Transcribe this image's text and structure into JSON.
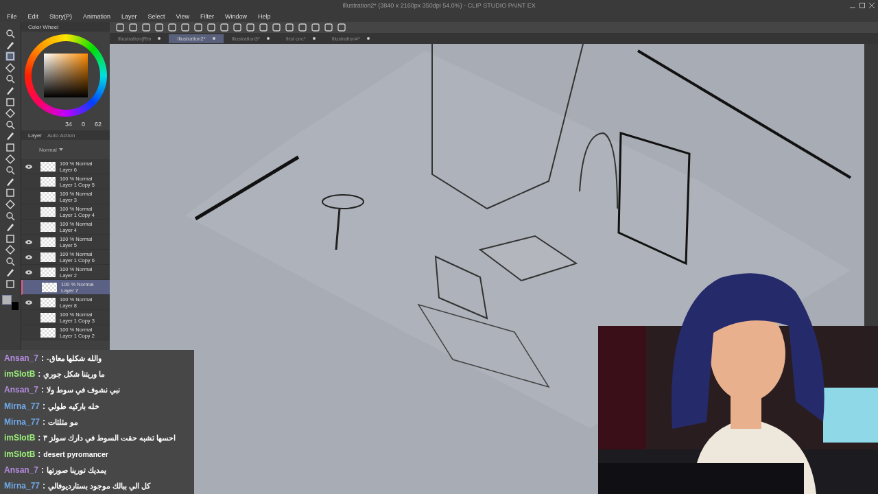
{
  "window": {
    "title": "Illustration2* (3840 x 2160px 350dpi 54.0%) - CLIP STUDIO PAINT EX"
  },
  "menu": [
    "File",
    "Edit",
    "Story(P)",
    "Animation",
    "Layer",
    "Select",
    "View",
    "Filter",
    "Window",
    "Help"
  ],
  "tabs": [
    {
      "label": "Illustration(Rm",
      "selected": false
    },
    {
      "label": "Illustration2*",
      "selected": true
    },
    {
      "label": "Illustration3*",
      "selected": false
    },
    {
      "label": "first cnc*",
      "selected": false
    },
    {
      "label": "Illustration4*",
      "selected": false
    }
  ],
  "color_panel": {
    "title": "Color Wheel",
    "readings": [
      "34",
      "0",
      "62"
    ]
  },
  "layer_panel": {
    "tabs": [
      {
        "label": "Layer",
        "selected": true
      },
      {
        "label": "Auto Action",
        "selected": false
      }
    ],
    "blend_mode": "Normal",
    "layers": [
      {
        "mode": "100 % Normal",
        "name": "Layer 6",
        "visible": true,
        "selected": false
      },
      {
        "mode": "100 % Normal",
        "name": "Layer 1 Copy 5",
        "visible": false,
        "selected": false
      },
      {
        "mode": "100 % Normal",
        "name": "Layer 3",
        "visible": false,
        "selected": false
      },
      {
        "mode": "100 % Normal",
        "name": "Layer 1 Copy 4",
        "visible": false,
        "selected": false
      },
      {
        "mode": "100 % Normal",
        "name": "Layer 4",
        "visible": false,
        "selected": false
      },
      {
        "mode": "100 % Normal",
        "name": "Layer 5",
        "visible": true,
        "selected": false
      },
      {
        "mode": "100 % Normal",
        "name": "Layer 1 Copy 6",
        "visible": true,
        "selected": false
      },
      {
        "mode": "100 % Normal",
        "name": "Layer 2",
        "visible": true,
        "selected": false
      },
      {
        "mode": "100 % Normal",
        "name": "Layer 7",
        "visible": false,
        "selected": true
      },
      {
        "mode": "100 % Normal",
        "name": "Layer 8",
        "visible": true,
        "selected": false
      },
      {
        "mode": "100 % Normal",
        "name": "Layer 1 Copy 3",
        "visible": false,
        "selected": false
      },
      {
        "mode": "100 % Normal",
        "name": "Layer 1 Copy 2",
        "visible": false,
        "selected": false
      }
    ]
  },
  "chat": {
    "separator": ":",
    "messages": [
      {
        "user": "Ansan_7",
        "color": "#b58be0",
        "text": "والله شكلها معاق-"
      },
      {
        "user": "imSlotB",
        "color": "#9cf07a",
        "text": "ما وريتنا شكل جوري"
      },
      {
        "user": "Ansan_7",
        "color": "#b58be0",
        "text": "نبي نشوف في سوط ولا"
      },
      {
        "user": "Mirna_77",
        "color": "#6fa8e6",
        "text": "خله باركيه طولي"
      },
      {
        "user": "Mirna_77",
        "color": "#6fa8e6",
        "text": "مو مثلثات"
      },
      {
        "user": "imSlotB",
        "color": "#9cf07a",
        "text": "احسها تشبه حقت السوط في دارك سولز ٣"
      },
      {
        "user": "imSlotB",
        "color": "#9cf07a",
        "text": "desert pyromancer"
      },
      {
        "user": "Ansan_7",
        "color": "#b58be0",
        "text": "يمديك تورينا صورتها"
      },
      {
        "user": "Mirna_77",
        "color": "#6fa8e6",
        "text": "كل الي ببالك موجود بستارديوفالي"
      }
    ]
  }
}
